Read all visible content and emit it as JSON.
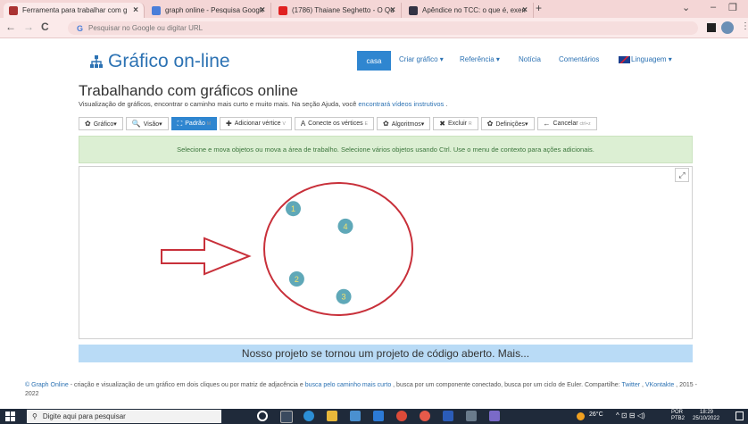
{
  "browser": {
    "tabs": [
      {
        "label": "Ferramenta para trabalhar com g",
        "icon": "graph-online-favicon",
        "color": "#a33"
      },
      {
        "label": "graph online - Pesquisa Google",
        "icon": "google-favicon",
        "color": "#4a7ed9"
      },
      {
        "label": "(1786) Thaiane Seghetto - O Qu",
        "icon": "youtube-favicon",
        "color": "#e02020"
      },
      {
        "label": "Apêndice no TCC: o que é, exem",
        "icon": "site-favicon",
        "color": "#334"
      }
    ],
    "new_tab_label": "+",
    "close_label": "×",
    "address_placeholder": "Pesquisar no Google ou digitar URL",
    "window_controls": [
      "⌄",
      "–",
      "❐",
      "✕"
    ]
  },
  "site": {
    "logo_text": "Gráfico on-line",
    "nav": [
      {
        "label": "casa",
        "active": true
      },
      {
        "label": "Criar gráfico ▾"
      },
      {
        "label": "Referência ▾"
      },
      {
        "label": "Notícia"
      },
      {
        "label": "Comentários"
      },
      {
        "label": "Linguagem ▾"
      }
    ],
    "title": "Trabalhando com gráficos online",
    "subtitle": "Visualização de gráficos, encontrar o caminho mais curto e muito mais. Na seção Ajuda, você ",
    "subtitle_link": "encontrará vídeos instrutivos",
    "subtitle_end": " .",
    "toolbar": [
      {
        "icon": "✿",
        "label": "Gráfico▾"
      },
      {
        "icon": "🔍",
        "label": "Visão▾"
      },
      {
        "icon": "⛶",
        "label": "Padrão",
        "sub": "M",
        "active": true
      },
      {
        "icon": "✚",
        "label": "Adicionar vértice",
        "sub": "V"
      },
      {
        "icon": "A",
        "label": "Conecte os vértices",
        "sub": "E"
      },
      {
        "icon": "✿",
        "label": "Algoritmos▾"
      },
      {
        "icon": "✖",
        "label": "Excluir",
        "sub": "R"
      },
      {
        "icon": "✿",
        "label": "Definições▾"
      },
      {
        "icon": "←",
        "label": "Cancelar",
        "sub": "ctrl+z"
      }
    ],
    "alert": "Selecione e mova objetos ou mova a área de trabalho. Selecione vários objetos usando Ctrl. Use o menu de contexto para ações adicionais.",
    "expand_icon": "⤢",
    "vertices": [
      {
        "label": "1",
        "x": 1,
        "y": 1
      },
      {
        "label": "4",
        "x": 4,
        "y": 2
      },
      {
        "label": "2",
        "x": 1.2,
        "y": 5
      },
      {
        "label": "3",
        "x": 3.9,
        "y": 6
      }
    ],
    "vertex_color": "#5fa8b8",
    "vertex_text_color": "#f5e26a",
    "annotation_color": "#c8303a",
    "banner": "Nosso projeto se tornou um projeto de código aberto. Mais...",
    "footer": {
      "link1": "© Graph Online",
      "text1": " - criação e visualização de um gráfico em dois cliques ou por matriz de adjacência e ",
      "link2": "busca pelo caminho mais curto",
      "text2": " , busca por um componente conectado, busca por um ciclo de Euler. Compartilhe: ",
      "link3": "Twitter",
      "sep": " , ",
      "link4": "VKontakte",
      "text3": " , 2015 - 2022"
    }
  },
  "taskbar": {
    "search_placeholder": "Digite aqui para pesquisar",
    "weather": "26°C",
    "lang": "POR PTB2",
    "time": "18:29",
    "date": "25/10/2022"
  }
}
